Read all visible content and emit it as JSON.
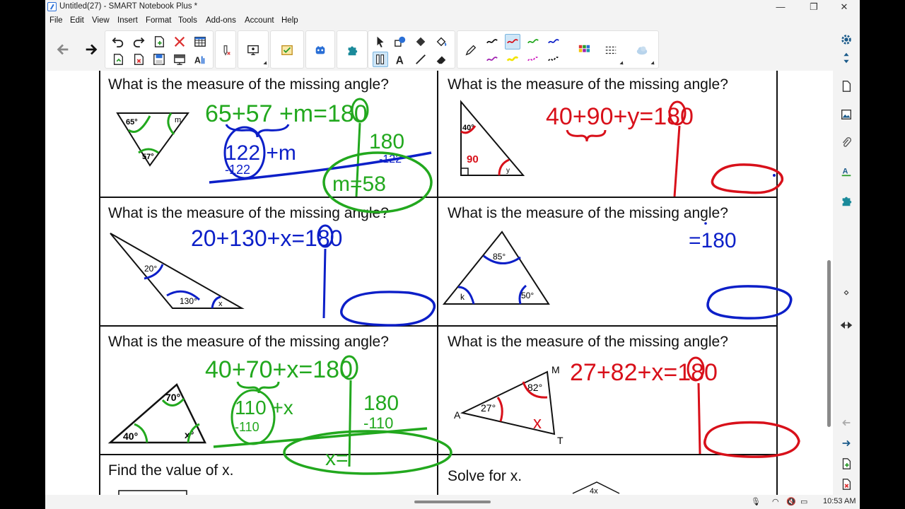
{
  "window": {
    "title": "Untitled(27) - SMART Notebook Plus *",
    "controls": [
      "—",
      "❐",
      "✕"
    ]
  },
  "menu": [
    "File",
    "Edit",
    "View",
    "Insert",
    "Format",
    "Tools",
    "Add-ons",
    "Account",
    "Help"
  ],
  "worksheet": {
    "cells": [
      {
        "question": "What is the measure of the missing angle?"
      },
      {
        "question": "What is the measure of the missing angle?"
      },
      {
        "question": "What is the measure of the missing angle?"
      },
      {
        "question": "What is the measure of the missing angle?"
      },
      {
        "question": "What is the measure of the missing angle?"
      },
      {
        "question": "What is the measure of the missing angle?"
      },
      {
        "question": "Find the value of x."
      },
      {
        "question": "Solve for x."
      }
    ],
    "figure_labels": {
      "t1": [
        "65°",
        "m",
        "57°"
      ],
      "t2": [
        "40°",
        "y"
      ],
      "t3": [
        "20°",
        "130°",
        "x"
      ],
      "t4": [
        "85°",
        "k",
        "50°"
      ],
      "t5": [
        "70°",
        "40°",
        "x°"
      ],
      "t6": [
        "M",
        "82°",
        "27°",
        "A",
        "T"
      ],
      "t8": [
        "4x"
      ]
    },
    "handwriting": {
      "c1_line1": "65+57 +m=180",
      "c1_line2": "122 +m",
      "c1_sub": "-122",
      "c1_180": "180",
      "c1_sub2": "-122",
      "c1_answer": "m=58",
      "c2_line1": "40+90+y=180",
      "c2_label": "90",
      "c3_line1": "20+130+x=180",
      "c4_line1": "=180",
      "c5_line1": "40+70+x=180",
      "c5_line2": "110 +x",
      "c5_sub": "-110",
      "c5_180": "180",
      "c5_sub2": "-110",
      "c5_answer": "x=",
      "c6_line1": "27+82+x=180",
      "c6_x": "x"
    }
  },
  "tray": {
    "time": "10:53 AM"
  },
  "colors": {
    "green": "#22a81e",
    "blue": "#0c1fc8",
    "red": "#d8101a"
  }
}
